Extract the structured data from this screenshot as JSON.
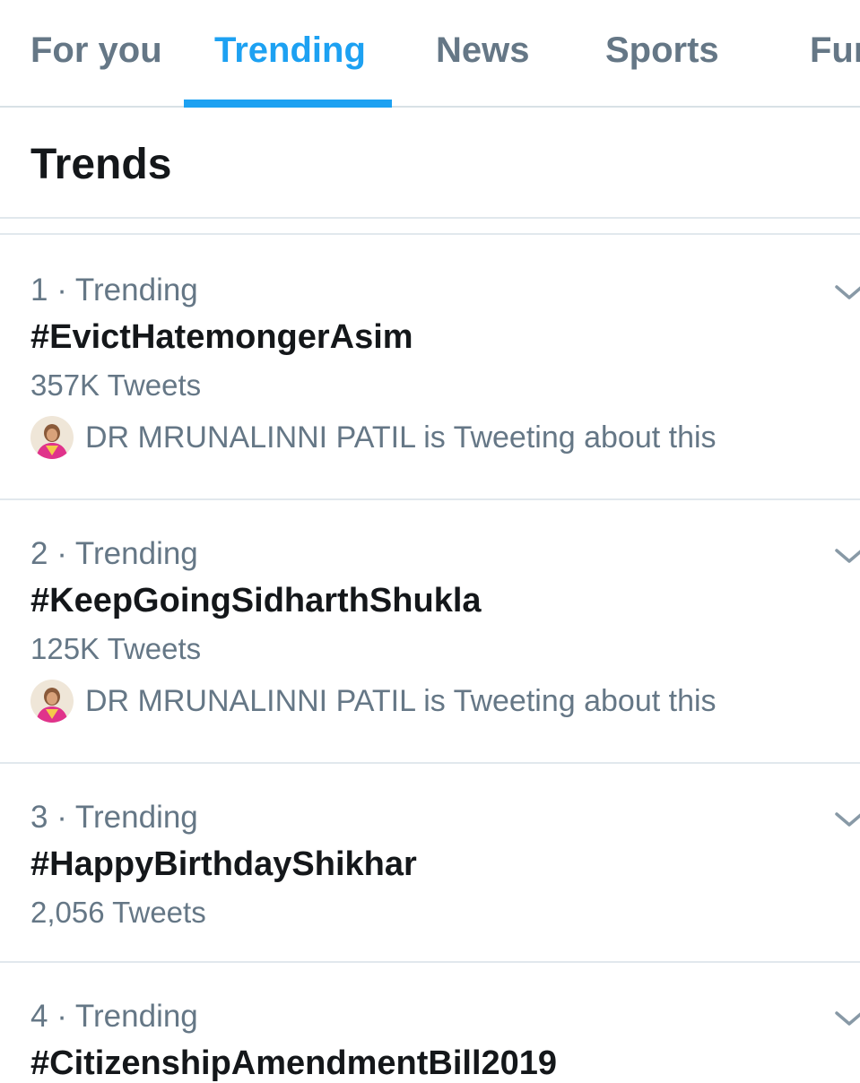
{
  "tabs": [
    {
      "label": "For you",
      "active": false
    },
    {
      "label": "Trending",
      "active": true
    },
    {
      "label": "News",
      "active": false
    },
    {
      "label": "Sports",
      "active": false
    },
    {
      "label": "Fun",
      "active": false
    }
  ],
  "header": {
    "title": "Trends"
  },
  "trends": [
    {
      "meta": "1 · Trending",
      "name": "#EvictHatemongerAsim",
      "count": "357K Tweets",
      "context": "DR  MRUNALINNI PATIL is Tweeting about this"
    },
    {
      "meta": "2 · Trending",
      "name": "#KeepGoingSidharthShukla",
      "count": "125K Tweets",
      "context": "DR  MRUNALINNI PATIL is Tweeting about this"
    },
    {
      "meta": "3 · Trending",
      "name": "#HappyBirthdayShikhar",
      "count": "2,056 Tweets"
    },
    {
      "meta": "4 · Trending",
      "name": "#CitizenshipAmendmentBill2019"
    }
  ],
  "colors": {
    "accent": "#1da1f2",
    "secondary_text": "#657786",
    "primary_text": "#14171a",
    "divider": "#e1e8ed"
  },
  "icons": {
    "caret": "chevron-down-icon",
    "avatar": "avatar"
  }
}
